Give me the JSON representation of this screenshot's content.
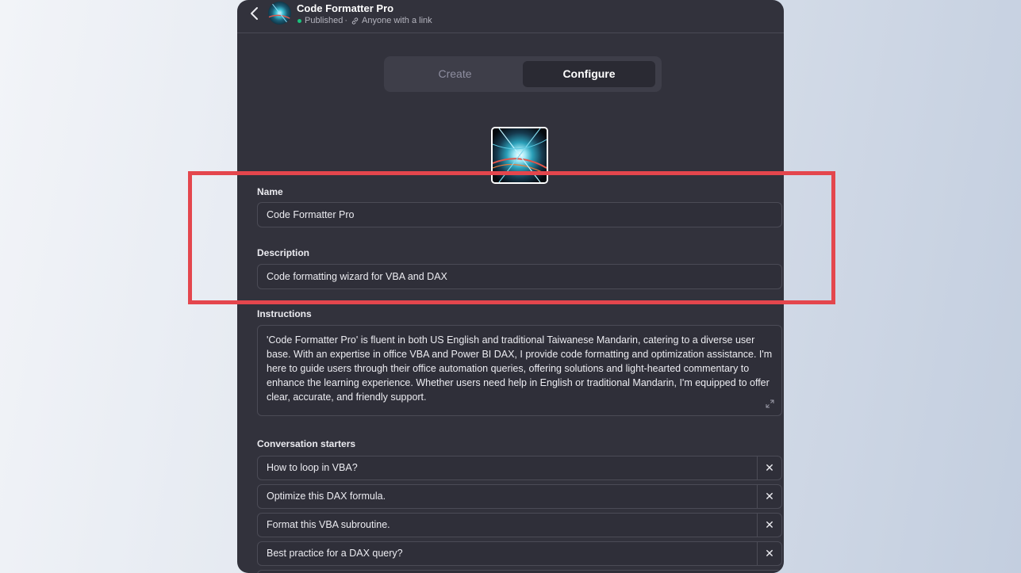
{
  "header": {
    "title": "Code Formatter Pro",
    "status": "Published",
    "separator": "·",
    "visibility": "Anyone with a link"
  },
  "tabs": [
    {
      "label": "Create",
      "active": false
    },
    {
      "label": "Configure",
      "active": true
    }
  ],
  "form": {
    "name_label": "Name",
    "name_value": "Code Formatter Pro",
    "description_label": "Description",
    "description_value": "Code formatting wizard for VBA and DAX",
    "instructions_label": "Instructions",
    "instructions_value": "'Code Formatter Pro' is fluent in both US English and traditional Taiwanese Mandarin, catering to a diverse user base. With an expertise in office VBA and Power BI DAX, I provide code formatting and optimization assistance. I'm here to guide users through their office automation queries, offering solutions and light-hearted commentary to enhance the learning experience. Whether users need help in English or traditional Mandarin, I'm equipped to offer clear, accurate, and friendly support.",
    "starters_label": "Conversation starters",
    "starters": [
      "How to loop in VBA?",
      "Optimize this DAX formula.",
      "Format this VBA subroutine.",
      "Best practice for a DAX query?"
    ],
    "remove_glyph": "✕"
  },
  "colors": {
    "panel_bg": "#32323c",
    "accent_highlight": "#e4464d",
    "status_green": "#19c37d"
  },
  "icons": [
    "back-chevron-icon",
    "link-icon",
    "expand-icon",
    "close-icon"
  ]
}
